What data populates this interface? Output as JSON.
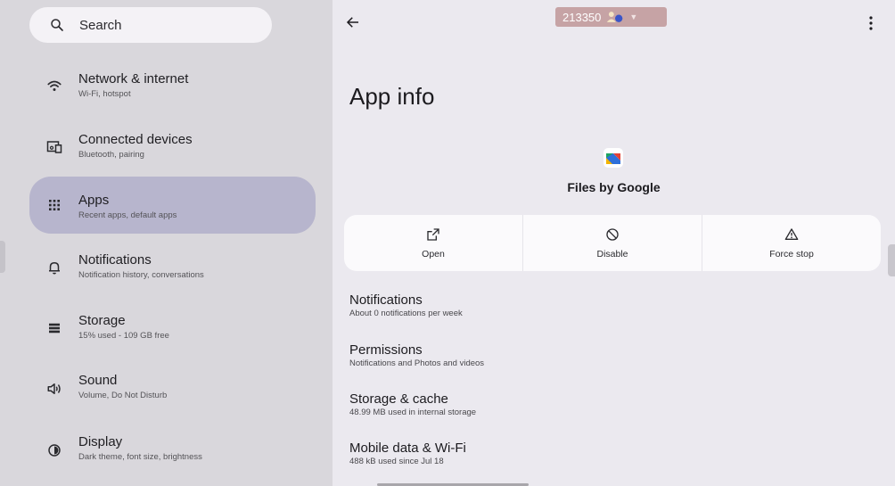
{
  "sidebar": {
    "search_label": "Search",
    "items": [
      {
        "title": "Network & internet",
        "subtitle": "Wi-Fi, hotspot",
        "icon": "wifi-icon"
      },
      {
        "title": "Connected devices",
        "subtitle": "Bluetooth, pairing",
        "icon": "devices-icon"
      },
      {
        "title": "Apps",
        "subtitle": "Recent apps, default apps",
        "icon": "apps-grid-icon",
        "selected": true
      },
      {
        "title": "Notifications",
        "subtitle": "Notification history, conversations",
        "icon": "bell-icon"
      },
      {
        "title": "Storage",
        "subtitle": "15% used - 109 GB free",
        "icon": "storage-icon"
      },
      {
        "title": "Sound",
        "subtitle": "Volume, Do Not Disturb",
        "icon": "volume-icon"
      },
      {
        "title": "Display",
        "subtitle": "Dark theme, font size, brightness",
        "icon": "brightness-icon"
      }
    ]
  },
  "header": {
    "status_chip_text": "213350"
  },
  "main": {
    "title": "App info",
    "app_name": "Files by Google",
    "actions": [
      {
        "label": "Open",
        "icon": "open-external-icon"
      },
      {
        "label": "Disable",
        "icon": "disable-icon"
      },
      {
        "label": "Force stop",
        "icon": "warning-icon"
      }
    ],
    "settings": [
      {
        "title": "Notifications",
        "subtitle": "About 0 notifications per week"
      },
      {
        "title": "Permissions",
        "subtitle": "Notifications and Photos and videos"
      },
      {
        "title": "Storage & cache",
        "subtitle": "48.99 MB used in internal storage"
      },
      {
        "title": "Mobile data & Wi-Fi",
        "subtitle": "488 kB used since Jul 18"
      }
    ]
  },
  "colors": {
    "selected_nav": "#b7b5cd",
    "left_background": "#d9d7dc",
    "right_background": "#ebe9ef",
    "status_chip": "#c6a3a5"
  }
}
